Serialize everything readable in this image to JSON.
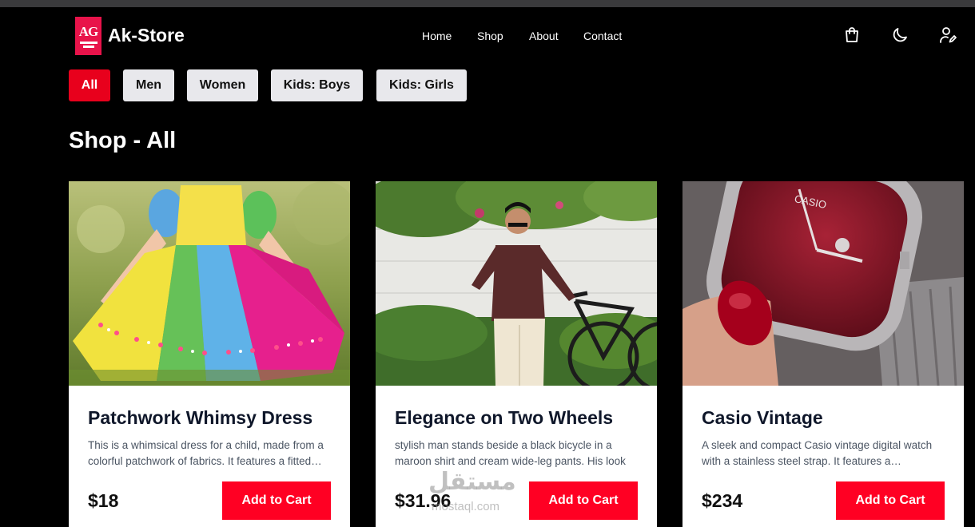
{
  "brand": {
    "monogram": "AG",
    "name": "Ak-Store",
    "logo_color": "#e8134a"
  },
  "nav": {
    "items": [
      {
        "label": "Home"
      },
      {
        "label": "Shop"
      },
      {
        "label": "About"
      },
      {
        "label": "Contact"
      }
    ]
  },
  "header_icons": [
    "shopping-bag-icon",
    "moon-icon",
    "user-edit-icon"
  ],
  "filters": {
    "items": [
      {
        "label": "All",
        "active": true
      },
      {
        "label": "Men",
        "active": false
      },
      {
        "label": "Women",
        "active": false
      },
      {
        "label": "Kids: Boys",
        "active": false
      },
      {
        "label": "Kids: Girls",
        "active": false
      }
    ],
    "active_color": "#e8001c"
  },
  "page": {
    "title": "Shop - All"
  },
  "products": [
    {
      "title": "Patchwork Whimsy Dress",
      "description": "This is a whimsical dress for a child, made from a colorful patchwork of fabrics. It features a fitted bodice",
      "price": "$18",
      "button": "Add to Cart"
    },
    {
      "title": "Elegance on Two Wheels",
      "description": "stylish man stands beside a black bicycle in a maroon shirt and cream wide-leg pants. His look",
      "price": "$31.96",
      "button": "Add to Cart"
    },
    {
      "title": "Casio Vintage",
      "description": "A sleek and compact Casio vintage digital watch with a stainless steel strap. It features a rectangular face",
      "price": "$234",
      "button": "Add to Cart"
    }
  ],
  "watermark": {
    "arabic": "مستقل",
    "latin": "mostaql.com"
  },
  "colors": {
    "background": "#000000",
    "card": "#ffffff",
    "cart_button": "#ff0023"
  }
}
